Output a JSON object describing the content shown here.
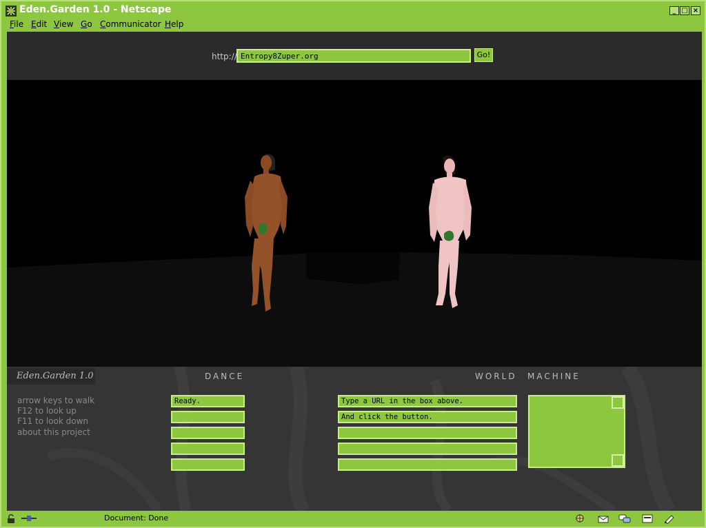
{
  "window": {
    "title": "Eden.Garden 1.0 - Netscape"
  },
  "menu": [
    {
      "label": "File",
      "hotkey": "F",
      "rest": "ile"
    },
    {
      "label": "Edit",
      "hotkey": "E",
      "rest": "dit"
    },
    {
      "label": "View",
      "hotkey": "V",
      "rest": "iew"
    },
    {
      "label": "Go",
      "hotkey": "G",
      "rest": "o"
    },
    {
      "label": "Communicator",
      "hotkey": "C",
      "rest": "ommunicator"
    },
    {
      "label": "Help",
      "hotkey": "H",
      "rest": "elp"
    }
  ],
  "address": {
    "prefix": "http://",
    "value": "Entropy8Zuper.org",
    "go_label": "Go!"
  },
  "panel": {
    "logo": "Eden.Garden 1.0",
    "dance_heading": "DANCE",
    "world_heading": "WORLD",
    "machine_heading": "MACHINE",
    "help": [
      "arrow keys to walk",
      "F12 to look up",
      "F11 to look down",
      "about this project"
    ],
    "dance_fields": [
      "Ready.",
      "",
      "",
      "",
      ""
    ],
    "world_fields": [
      "Type a URL in the box above.",
      "And click the button.",
      "",
      "",
      ""
    ]
  },
  "status": {
    "text": "Document: Done"
  },
  "icons": {
    "title": "netscape-icon",
    "status_left": [
      "lock-icon",
      "connection-icon"
    ],
    "status_right": [
      "navigator-icon",
      "mail-icon",
      "discussion-icon",
      "composer-icon",
      "security-icon"
    ]
  },
  "colors": {
    "accent": "#8dc63f",
    "accent_light": "#c9ec8f",
    "panel": "#353535",
    "scene": "#000000"
  }
}
